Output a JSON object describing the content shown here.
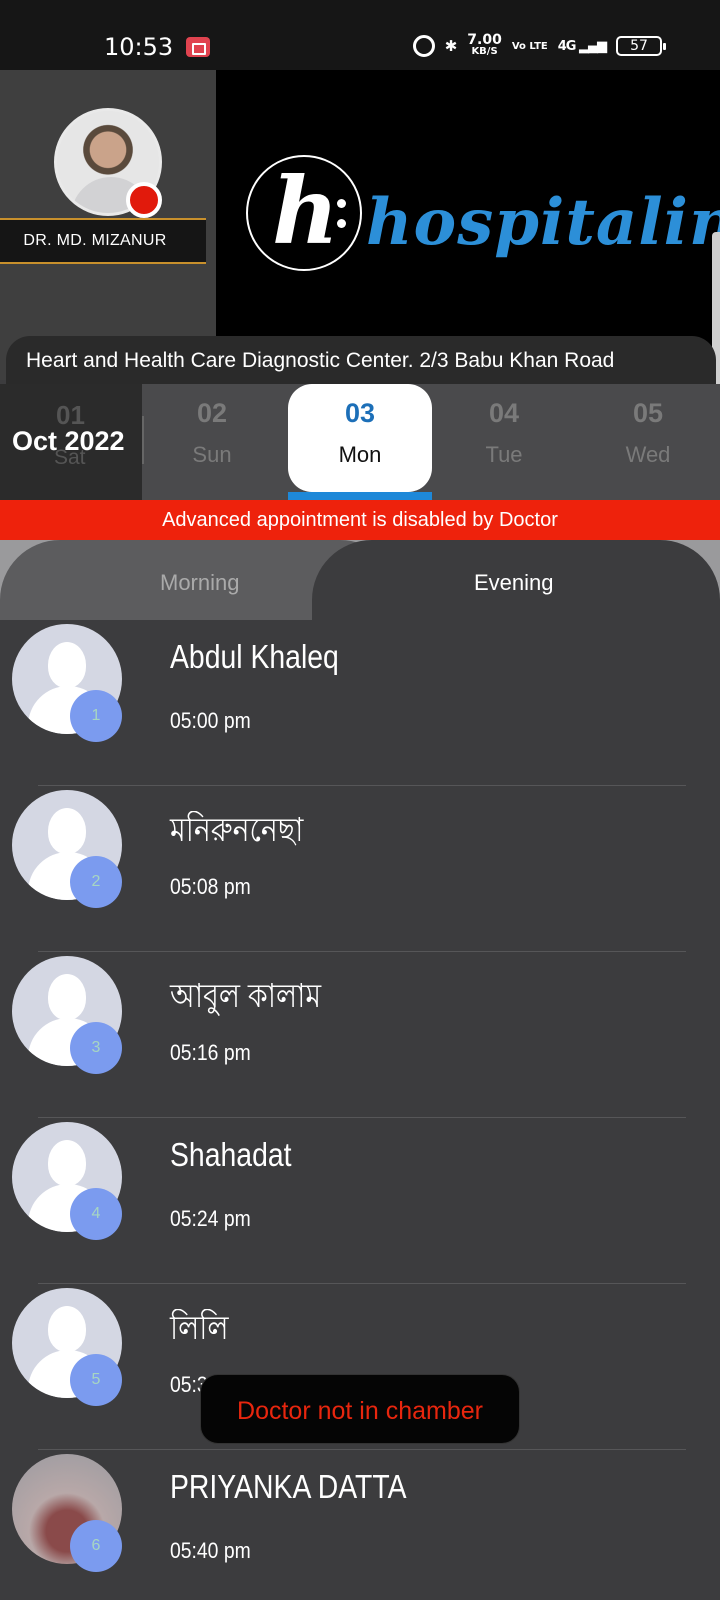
{
  "status_bar": {
    "time": "10:53",
    "speed_value": "7.00",
    "speed_unit": "KB/S",
    "volte": "Vo LTE",
    "network": "4G",
    "battery": "57"
  },
  "header": {
    "doctor_name": "DR. MD. MIZANUR",
    "logo_text": "hospitalin",
    "logo_mark": "h",
    "address": "Heart and Health Care Diagnostic Center. 2/3 Babu Khan Road"
  },
  "date_strip": {
    "month": "Oct 2022",
    "ghost_day": "01",
    "ghost_dow": "Sat",
    "days": [
      {
        "num": "02",
        "dow": "Sun"
      },
      {
        "num": "03",
        "dow": "Mon"
      },
      {
        "num": "04",
        "dow": "Tue"
      },
      {
        "num": "05",
        "dow": "Wed"
      }
    ]
  },
  "notice": "Advanced appointment is disabled by Doctor",
  "tabs": {
    "morning": "Morning",
    "evening": "Evening",
    "selected": "Evening"
  },
  "appointments": [
    {
      "serial": "1",
      "name": "Abdul Khaleq",
      "time": "05:00 pm"
    },
    {
      "serial": "2",
      "name": "মনিরুননেছা",
      "time": "05:08 pm"
    },
    {
      "serial": "3",
      "name": "আবুল কালাম",
      "time": "05:16 pm"
    },
    {
      "serial": "4",
      "name": "Shahadat",
      "time": "05:24 pm"
    },
    {
      "serial": "5",
      "name": "লিলি",
      "time": "05:32 pm"
    },
    {
      "serial": "6",
      "name": "PRIYANKA DATTA",
      "time": "05:40 pm"
    }
  ],
  "toast": "Doctor not in chamber",
  "colors": {
    "accent_blue": "#1e88d8",
    "notice_red": "#ee220c",
    "serial_badge": "#7b9bef",
    "doctor_status": "#e11a0c",
    "name_bar_border": "#c8902c"
  }
}
